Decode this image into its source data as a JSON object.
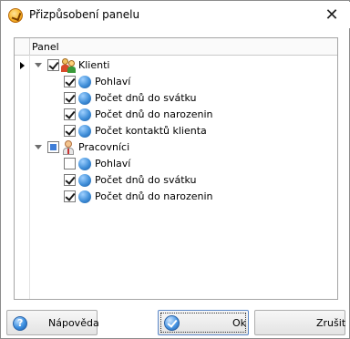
{
  "window": {
    "title": "Přizpůsobení panelu",
    "close_glyph": "✕"
  },
  "panel": {
    "header_label": "Panel",
    "groups": [
      {
        "label": "Klienti",
        "icon": "clients-icon",
        "state": "checked",
        "expanded": true,
        "children": [
          {
            "label": "Pohlaví",
            "checked": true
          },
          {
            "label": "Počet dnů do svátku",
            "checked": true
          },
          {
            "label": "Počet dnů do narozenin",
            "checked": true
          },
          {
            "label": "Počet kontaktů klienta",
            "checked": true
          }
        ]
      },
      {
        "label": "Pracovníci",
        "icon": "worker-icon",
        "state": "partial",
        "expanded": true,
        "children": [
          {
            "label": "Pohlaví",
            "checked": false
          },
          {
            "label": "Počet dnů do svátku",
            "checked": true
          },
          {
            "label": "Počet dnů do narozenin",
            "checked": true
          }
        ]
      }
    ]
  },
  "buttons": {
    "help": "Nápověda",
    "ok": "Ok",
    "cancel": "Zrušit"
  }
}
